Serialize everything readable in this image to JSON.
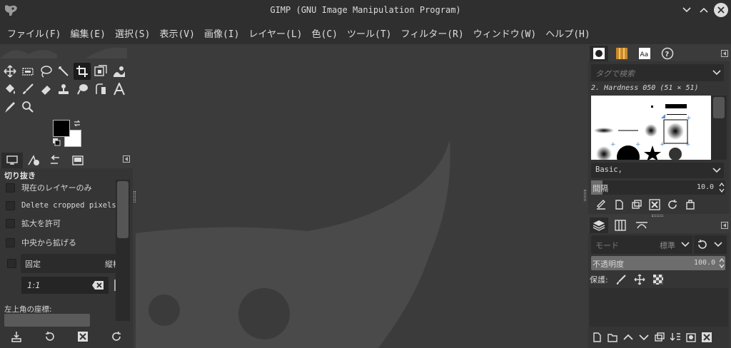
{
  "window": {
    "title": "GIMP (GNU Image Manipulation Program)"
  },
  "menu": [
    "ファイル(F)",
    "編集(E)",
    "選択(S)",
    "表示(V)",
    "画像(I)",
    "レイヤー(L)",
    "色(C)",
    "ツール(T)",
    "フィルター(R)",
    "ウィンドウ(W)",
    "ヘルプ(H)"
  ],
  "tool_options": {
    "title": "切り抜き",
    "current_layer_only": "現在のレイヤーのみ",
    "delete_cropped": "Delete cropped pixels",
    "allow_growing": "拡大を許可",
    "expand_from_center": "中央から拡げる",
    "fixed": "固定",
    "fixed_mode": "縦横",
    "ratio_value": "1:1",
    "position_label": "左上角の座標:"
  },
  "brushes": {
    "filter_placeholder": "タグで検索",
    "current_brush": "2. Hardness 050 (51 × 51)",
    "preset": "Basic,",
    "spacing_label": "間隔",
    "spacing_value": "10.0"
  },
  "layers": {
    "mode_label": "モード",
    "mode_value": "標準",
    "opacity_label": "不透明度",
    "opacity_value": "100.0",
    "lock_label": "保護:"
  },
  "colors": {
    "foreground": "#000000",
    "background": "#ffffff",
    "chrome": "#2f2f2f",
    "panel": "#3b3b3b"
  }
}
